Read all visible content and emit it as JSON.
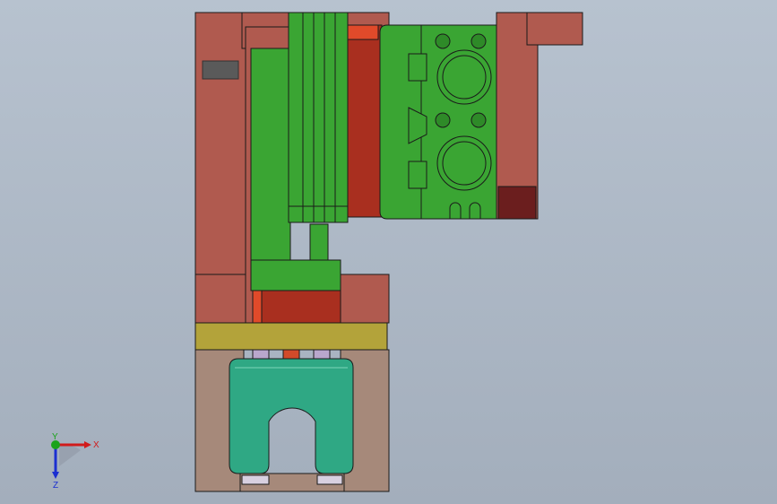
{
  "viewport": {
    "background_top": "#b7c2cf",
    "background_bottom": "#a3aebc"
  },
  "colors": {
    "plate_brown": "#b05a4f",
    "plate_brown_dark": "#7a2f2a",
    "block_red": "#a92f1f",
    "part_green": "#3aa533",
    "part_green_dark": "#1f6d1a",
    "plate_yellow": "#b3a33a",
    "fixture_tan": "#a6897a",
    "clamp_teal": "#2fa884",
    "pin_lavender": "#b9a7cc",
    "edge_dark": "#1a1a1a"
  },
  "triad": {
    "x_label": "X",
    "y_label": "Y",
    "z_label": "Z",
    "x_color": "#d11b1b",
    "y_color": "#1aa31a",
    "z_color": "#1b2fd1"
  }
}
